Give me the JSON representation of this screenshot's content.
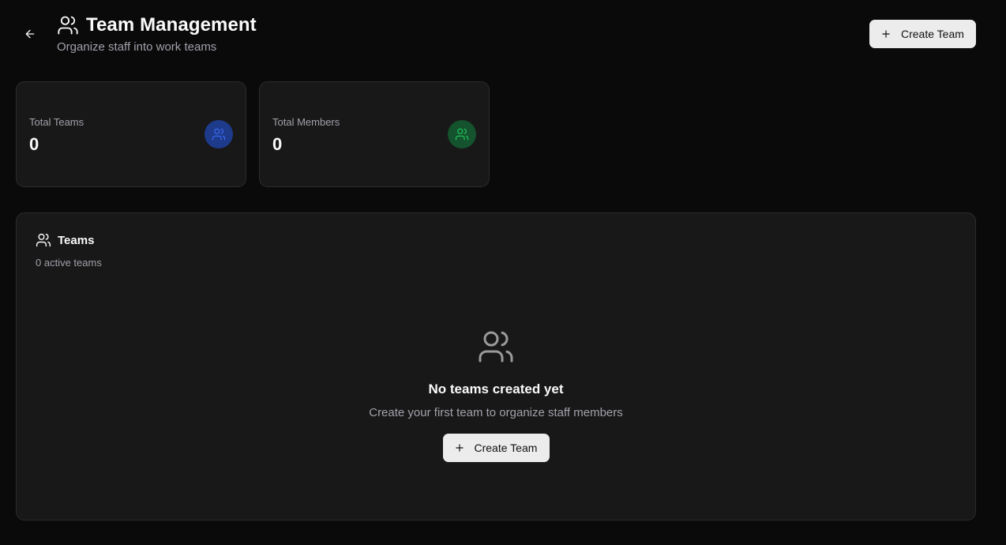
{
  "header": {
    "title": "Team Management",
    "subtitle": "Organize staff into work teams",
    "create_button_label": "Create Team"
  },
  "stats": [
    {
      "label": "Total Teams",
      "value": "0",
      "icon": "users-icon",
      "icon_color": "#3b6cf6",
      "icon_bg": "#1e3a8a"
    },
    {
      "label": "Total Members",
      "value": "0",
      "icon": "users-icon",
      "icon_color": "#22c55e",
      "icon_bg": "#14532d"
    }
  ],
  "teams_panel": {
    "title": "Teams",
    "subtitle": "0 active teams",
    "empty_state": {
      "icon": "users-icon",
      "title": "No teams created yet",
      "description": "Create your first team to organize staff members",
      "button_label": "Create Team"
    }
  }
}
